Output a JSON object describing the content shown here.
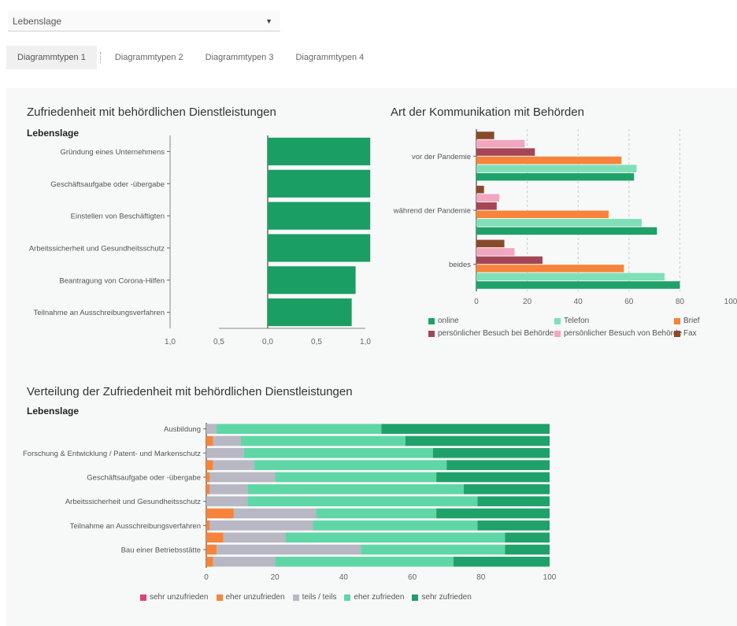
{
  "dropdown": {
    "value": "Lebenslage"
  },
  "tabs": [
    {
      "label": "Diagrammtypen 1"
    },
    {
      "label": "Diagrammtypen 2"
    },
    {
      "label": "Diagrammtypen 3"
    },
    {
      "label": "Diagrammtypen 4"
    }
  ],
  "colors": {
    "dark_green": "#1a9e63",
    "online": "#1fa16a",
    "telefon": "#7fe0b8",
    "brief": "#f7843a",
    "persoenlich_bei": "#a54654",
    "persoenlich_von": "#f2a6c0",
    "fax": "#8a4a2a",
    "sehr_unzufrieden": "#e0446a",
    "eher_unzufrieden": "#f7843a",
    "teils": "#b8b8c4",
    "eher_zufrieden": "#5fd6a6",
    "sehr_zufrieden": "#1fa16a"
  },
  "chart_data": [
    {
      "id": "chart1",
      "type": "bar",
      "orientation": "horizontal",
      "title": "Zufriedenheit mit behördlichen Dienstleistungen",
      "subtitle": "Lebenslage",
      "categories": [
        "Gründung eines Unternehmens",
        "Geschäftsaufgabe oder -übergabe",
        "Einstellen von Beschäftigten",
        "Arbeitssicherheit und Gesundheitsschutz",
        "Beantragung von Corona-Hilfen",
        "Teilnahme an Ausschreibungsverfahren"
      ],
      "values": [
        1.05,
        1.05,
        1.05,
        1.05,
        0.9,
        0.86
      ],
      "xlim": [
        -1.0,
        1.0
      ],
      "xticks": [
        -1.0,
        -0.5,
        0.0,
        0.5,
        1.0
      ],
      "xtick_labels": [
        "1,0",
        "0,5",
        "0,0",
        "0,5",
        "1,0"
      ]
    },
    {
      "id": "chart2",
      "type": "bar",
      "orientation": "horizontal",
      "title": "Art der Kommunikation mit Behörden",
      "categories": [
        "vor der Pandemie",
        "während der Pandemie",
        "beides"
      ],
      "series": [
        {
          "name": "Fax",
          "values": [
            7,
            3,
            11
          ]
        },
        {
          "name": "persönlicher Besuch von Behörde",
          "values": [
            19,
            9,
            15
          ]
        },
        {
          "name": "persönlicher Besuch bei Behörde",
          "values": [
            23,
            8,
            26
          ]
        },
        {
          "name": "Brief",
          "values": [
            57,
            52,
            58
          ]
        },
        {
          "name": "Telefon",
          "values": [
            63,
            65,
            74
          ]
        },
        {
          "name": "online",
          "values": [
            62,
            71,
            80
          ]
        }
      ],
      "legend_order": [
        "online",
        "Telefon",
        "Brief",
        "persönlicher Besuch bei Behörde",
        "persönlicher Besuch von Behörde",
        "Fax"
      ],
      "xlim": [
        0,
        100
      ],
      "xticks": [
        0,
        20,
        40,
        60,
        80,
        100
      ],
      "xtick_labels": [
        "0",
        "20",
        "40",
        "60",
        "80",
        "100"
      ],
      "legend_position": "bottom"
    },
    {
      "id": "chart3",
      "type": "bar",
      "orientation": "horizontal",
      "stacked": true,
      "title": "Verteilung der Zufriedenheit mit behördlichen Dienstleistungen",
      "subtitle": "Lebenslage",
      "labeled_rows": [
        {
          "row": 0,
          "label": "Ausbildung"
        },
        {
          "row": 2,
          "label": "Forschung & Entwicklung / Patent- und Markenschutz"
        },
        {
          "row": 4,
          "label": "Geschäftsaufgabe oder -übergabe"
        },
        {
          "row": 6,
          "label": "Arbeitssicherheit und Gesundheitsschutz"
        },
        {
          "row": 8,
          "label": "Teilnahme an Ausschreibungsverfahren"
        },
        {
          "row": 10,
          "label": "Bau einer Betriebsstätte"
        }
      ],
      "rows": [
        [
          0,
          0,
          3,
          48,
          49
        ],
        [
          0,
          2,
          8,
          48,
          42
        ],
        [
          0,
          0,
          11,
          55,
          34
        ],
        [
          0,
          2,
          12,
          56,
          30
        ],
        [
          0,
          1,
          19,
          47,
          33
        ],
        [
          0,
          1,
          11,
          63,
          25
        ],
        [
          0,
          0,
          12,
          67,
          21
        ],
        [
          0,
          8,
          24,
          35,
          33
        ],
        [
          0,
          1,
          30,
          48,
          21
        ],
        [
          0,
          5,
          18,
          64,
          13
        ],
        [
          0,
          3,
          42,
          42,
          13
        ],
        [
          0,
          2,
          18,
          52,
          28
        ]
      ],
      "series_names": [
        "sehr unzufrieden",
        "eher unzufrieden",
        "teils / teils",
        "eher zufrieden",
        "sehr zufrieden"
      ],
      "xlim": [
        0,
        100
      ],
      "xticks": [
        0,
        20,
        40,
        60,
        80,
        100
      ],
      "xtick_labels": [
        "0",
        "20",
        "40",
        "60",
        "80",
        "100"
      ],
      "legend_position": "bottom"
    }
  ]
}
